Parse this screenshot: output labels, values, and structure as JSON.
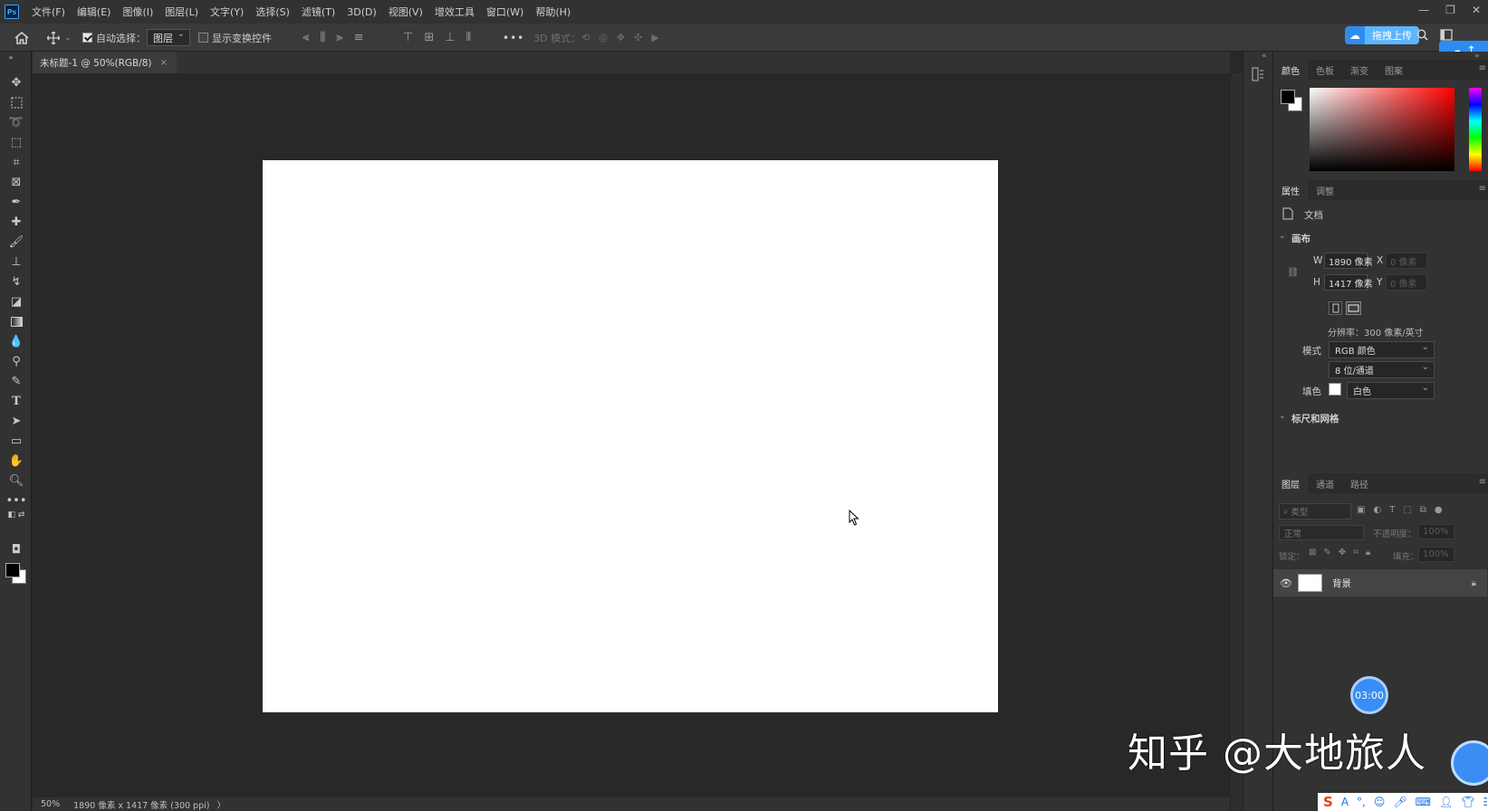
{
  "app": {
    "logo": "Ps",
    "menu": [
      "文件(F)",
      "编辑(E)",
      "图像(I)",
      "图层(L)",
      "文字(Y)",
      "选择(S)",
      "滤镜(T)",
      "3D(D)",
      "视图(V)",
      "增效工具",
      "窗口(W)",
      "帮助(H)"
    ],
    "window_controls": [
      "—",
      "❐",
      "✕"
    ]
  },
  "options": {
    "auto_select_label": "自动选择：",
    "auto_select_checked": true,
    "layer_select_value": "图层",
    "show_transform_label": "显示变换控件",
    "show_transform_checked": false,
    "more": "•••",
    "mode_3d_label": "3D 模式：",
    "upload_label": "拖拽上传"
  },
  "document": {
    "tab_title": "未标题-1 @ 50%(RGB/8)",
    "tab_close": "×",
    "zoom": "50%",
    "size_info": "1890 像素 x 1417 像素 (300 ppi)",
    "status_arrow": "〉"
  },
  "color_panel": {
    "tabs": [
      "颜色",
      "色板",
      "渐变",
      "图案"
    ],
    "foreground": "#000000",
    "background": "#ffffff"
  },
  "properties_panel": {
    "tabs": [
      "属性",
      "调整"
    ],
    "doc_label": "文档",
    "canvas_section": "画布",
    "w_label": "W",
    "w_value": "1890 像素",
    "h_label": "H",
    "h_value": "1417 像素",
    "x_label": "X",
    "x_value": "0 像素",
    "y_label": "Y",
    "y_value": "0 像素",
    "resolution": "分辨率：300 像素/英寸",
    "mode_label": "模式",
    "mode_value": "RGB 颜色",
    "depth_value": "8 位/通道",
    "fill_label": "填色",
    "fill_value": "白色",
    "rulers_section": "标尺和网格"
  },
  "layers_panel": {
    "tabs": [
      "图层",
      "通道",
      "路径"
    ],
    "search_placeholder": "类型",
    "blend_mode": "正常",
    "opacity_label": "不透明度：",
    "opacity_value": "100%",
    "lock_label": "锁定：",
    "fill_label": "填充：",
    "fill_value": "100%",
    "layers": [
      {
        "name": "背景",
        "visible": true,
        "locked": true
      }
    ]
  },
  "overlay": {
    "timer": "03:00",
    "watermark": "知乎 @大地旅人"
  },
  "colors": {
    "accent": "#31a8ff",
    "canvas": "#ffffff",
    "workspace": "#282828",
    "panel": "#323232"
  }
}
